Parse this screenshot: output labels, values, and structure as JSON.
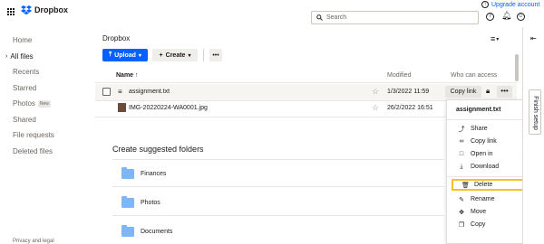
{
  "app": {
    "logo_text": "Dropbox"
  },
  "header": {
    "upgrade_label": "Upgrade account",
    "search_placeholder": "Search"
  },
  "sidebar": {
    "items": [
      {
        "label": "Home"
      },
      {
        "label": "All files"
      },
      {
        "label": "Recents"
      },
      {
        "label": "Starred"
      },
      {
        "label": "Photos",
        "badge": "New"
      },
      {
        "label": "Shared"
      },
      {
        "label": "File requests"
      },
      {
        "label": "Deleted files"
      }
    ],
    "footer": "Privacy and legal"
  },
  "main": {
    "breadcrumb": "Dropbox",
    "upload_label": "Upload",
    "create_label": "Create",
    "columns": {
      "name": "Name",
      "modified": "Modified",
      "access": "Who can access"
    },
    "files": [
      {
        "name": "assignment.txt",
        "modified": "1/3/2022 11:59",
        "copy_link": "Copy link"
      },
      {
        "name": "IMG-20220224-WA0001.jpg",
        "modified": "26/2/2022 16:51"
      }
    ],
    "suggest_title": "Create suggested folders",
    "folders": [
      {
        "name": "Finances"
      },
      {
        "name": "Photos"
      },
      {
        "name": "Documents"
      }
    ]
  },
  "context_menu": {
    "title": "assignment.txt",
    "items": [
      {
        "label": "Share",
        "icon": "share-icon"
      },
      {
        "label": "Copy link",
        "icon": "link-icon"
      },
      {
        "label": "Open in",
        "icon": "open-in-icon"
      },
      {
        "label": "Download",
        "icon": "download-icon"
      },
      {
        "label": "Delete",
        "icon": "trash-icon"
      },
      {
        "label": "Rename",
        "icon": "rename-icon"
      },
      {
        "label": "Move",
        "icon": "move-icon"
      },
      {
        "label": "Copy",
        "icon": "copy-icon"
      }
    ]
  },
  "right_rail": {
    "tab_label": "Finish setup"
  },
  "colors": {
    "accent": "#0061fe",
    "highlight": "#f5c02a",
    "folder": "#7fb6f5"
  }
}
